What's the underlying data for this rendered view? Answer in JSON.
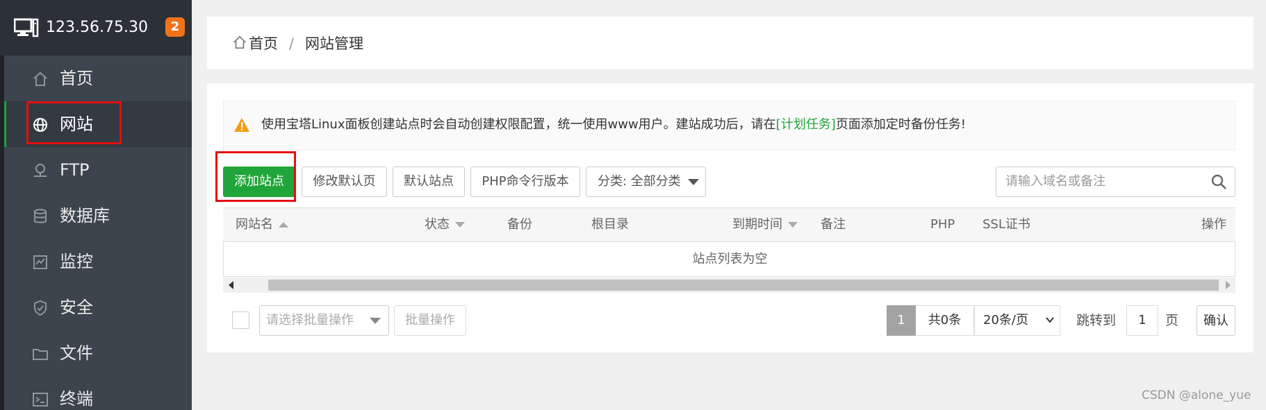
{
  "server": {
    "ip": "123.56.75.30",
    "badge": "2"
  },
  "sidebar": {
    "items": [
      {
        "label": "首页",
        "icon": "home-icon"
      },
      {
        "label": "网站",
        "icon": "globe-icon"
      },
      {
        "label": "FTP",
        "icon": "ftp-icon"
      },
      {
        "label": "数据库",
        "icon": "database-icon"
      },
      {
        "label": "监控",
        "icon": "monitor-icon"
      },
      {
        "label": "安全",
        "icon": "shield-icon"
      },
      {
        "label": "文件",
        "icon": "folder-icon"
      },
      {
        "label": "终端",
        "icon": "terminal-icon"
      }
    ],
    "active_index": 1
  },
  "breadcrumb": {
    "home": "首页",
    "separator": "/",
    "current": "网站管理"
  },
  "notice": {
    "text_before": "使用宝塔Linux面板创建站点时会自动创建权限配置，统一使用www用户。建站成功后，请在",
    "link": "[计划任务]",
    "text_after": "页面添加定时备份任务!"
  },
  "toolbar": {
    "add_site": "添加站点",
    "edit_default_page": "修改默认页",
    "default_site": "默认站点",
    "php_cli_version": "PHP命令行版本",
    "category": "分类: 全部分类"
  },
  "search": {
    "placeholder": "请输入域名或备注"
  },
  "table": {
    "columns": [
      "网站名",
      "状态",
      "备份",
      "根目录",
      "到期时间",
      "备注",
      "PHP",
      "SSL证书",
      "操作"
    ],
    "empty_text": "站点列表为空"
  },
  "footer": {
    "batch_placeholder": "请选择批量操作",
    "batch_button": "批量操作",
    "current_page": "1",
    "total": "共0条",
    "page_size": "20条/页",
    "jump_label": "跳转到",
    "jump_value": "1",
    "page_unit": "页",
    "confirm": "确认"
  },
  "watermark": "CSDN @alone_yue",
  "colors": {
    "accent": "#20a53a",
    "sidebar_bg": "#3c444d",
    "badge": "#f0731a",
    "highlight": "#e50e0e"
  }
}
